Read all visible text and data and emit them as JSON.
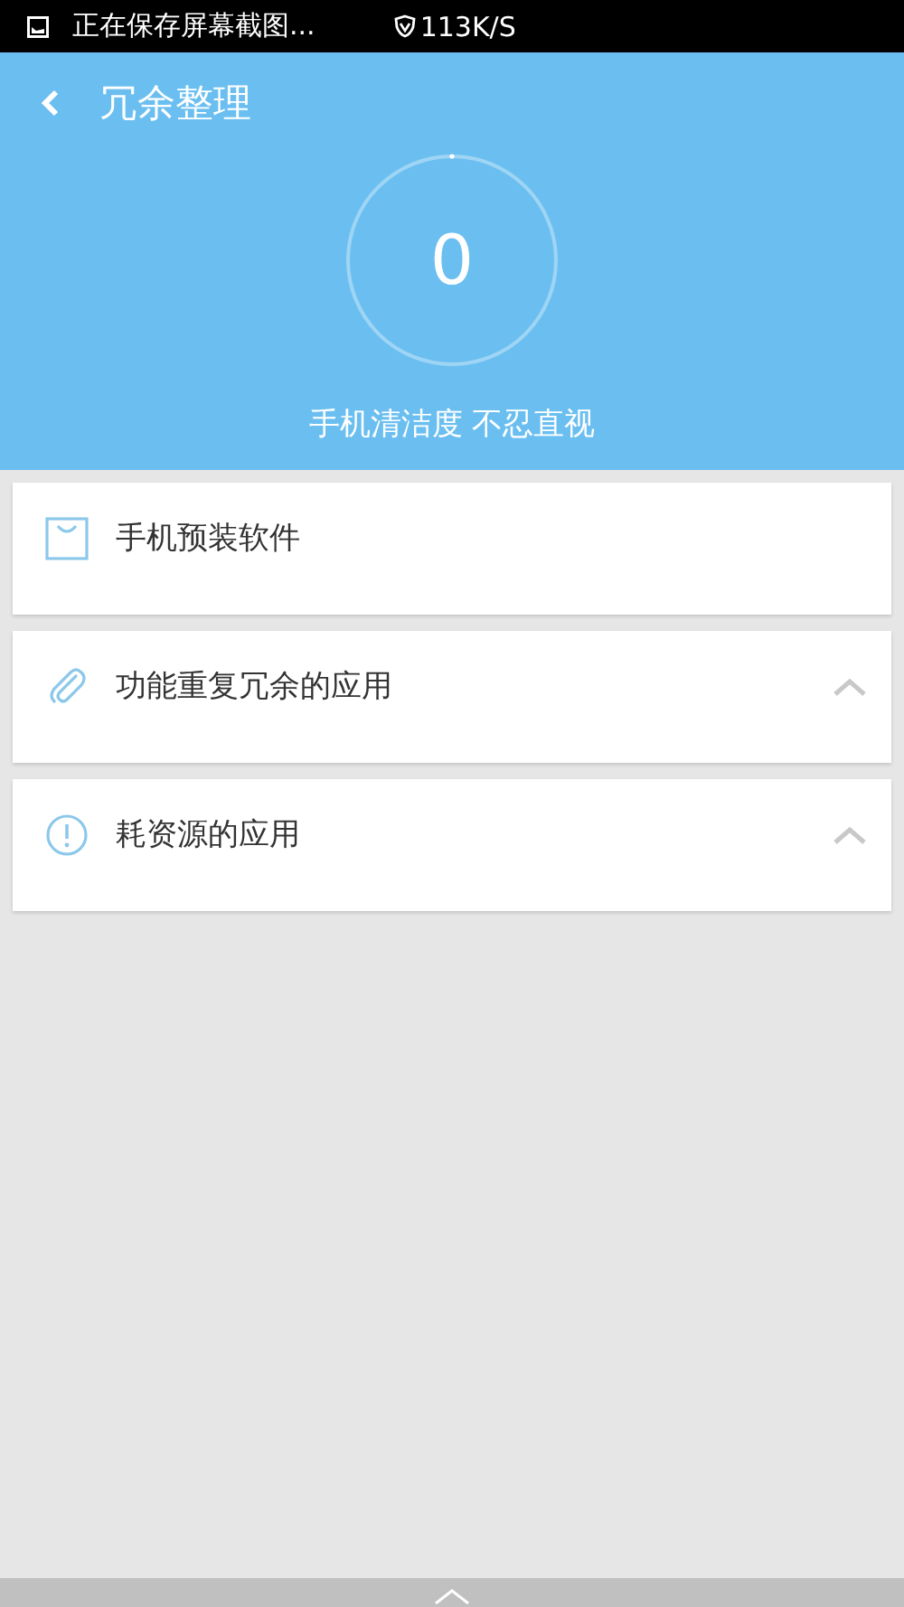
{
  "status_bar": {
    "notification": "正在保存屏幕截图...",
    "speed": "113K/S"
  },
  "header": {
    "title": "冗余整理",
    "score": "0",
    "caption": "手机清洁度 不忍直视"
  },
  "sections": [
    {
      "label": "手机预装软件",
      "expandable": false
    },
    {
      "label": "功能重复冗余的应用",
      "expandable": true
    },
    {
      "label": "耗资源的应用",
      "expandable": true
    }
  ]
}
